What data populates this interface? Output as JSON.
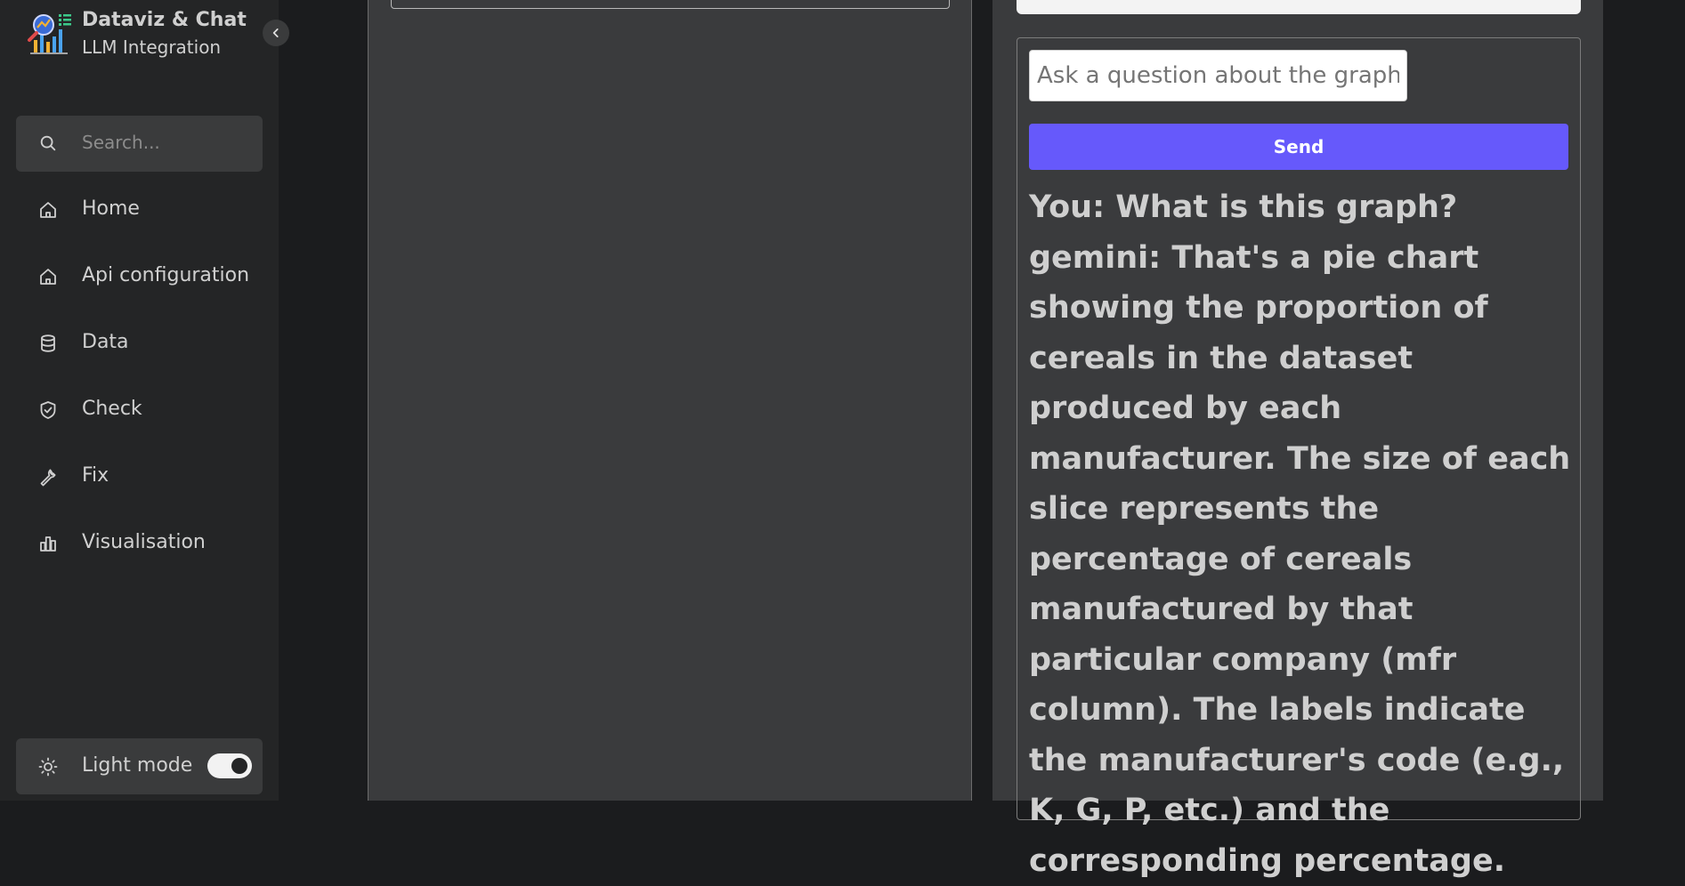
{
  "app": {
    "title": "Dataviz & Chat",
    "subtitle": "LLM Integration"
  },
  "sidebar": {
    "search_placeholder": "Search...",
    "items": [
      {
        "label": "Home",
        "icon": "home-icon"
      },
      {
        "label": "Api configuration",
        "icon": "home-icon"
      },
      {
        "label": "Data",
        "icon": "database-icon"
      },
      {
        "label": "Check",
        "icon": "shield-check-icon"
      },
      {
        "label": "Fix",
        "icon": "wrench-icon"
      },
      {
        "label": "Visualisation",
        "icon": "bar-chart-icon"
      }
    ],
    "mode_label": "Light mode",
    "mode_toggle_on": true
  },
  "chat": {
    "input_placeholder": "Ask a question about the graph",
    "send_label": "Send",
    "messages": [
      "You: What is this graph?",
      "gemini: That's a pie chart showing the proportion of cereals in the dataset produced by each manufacturer. The size of each slice represents the percentage of cereals manufactured by that particular company (mfr column). The labels indicate the manufacturer's code (e.g., K, G, P, etc.) and the corresponding percentage."
    ]
  },
  "colors": {
    "sidebar_bg": "#242526",
    "panel_bg": "#3a3b3d",
    "accent": "#6659fb"
  }
}
